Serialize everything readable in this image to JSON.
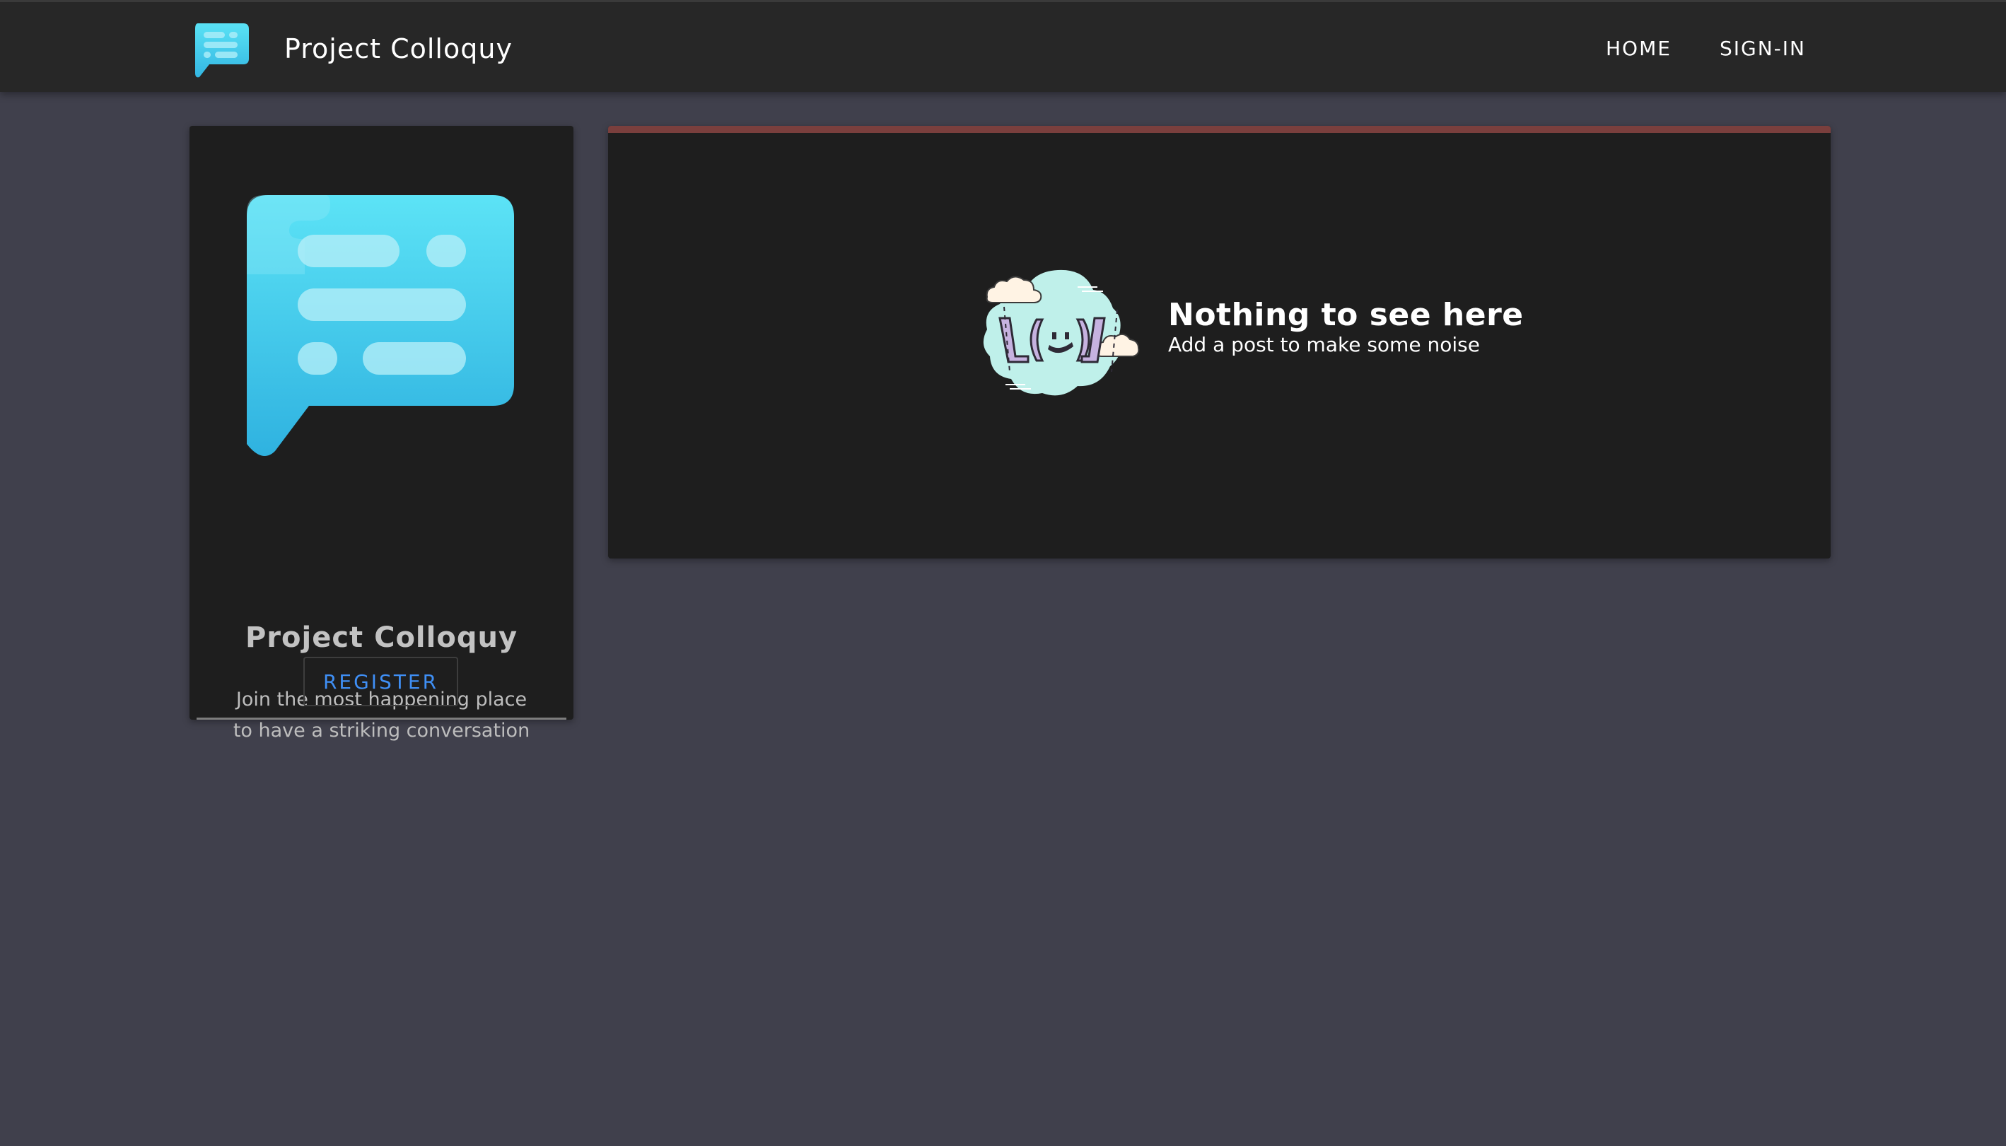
{
  "header": {
    "brand_title": "Project Colloquy",
    "logo_icon": "chat-bubble-icon",
    "nav": [
      {
        "label": "HOME"
      },
      {
        "label": "SIGN-IN"
      }
    ]
  },
  "sidebar_card": {
    "logo_icon": "chat-bubble-icon",
    "title": "Project Colloquy",
    "description_line1": "Join the most happening place",
    "description_line2": "to have a striking conversation",
    "register_label": "REGISTER"
  },
  "main": {
    "empty_state": {
      "illustration": "shrug-cloud-illustration",
      "title": "Nothing to see here",
      "subtitle": "Add a post to make some noise"
    }
  },
  "colors": {
    "page_background": "#40404c",
    "header_background": "#272727",
    "card_background": "#1e1e1e",
    "accent_bar": "#7a3f3d",
    "link_blue": "#3f8ff5",
    "logo_cyan": "#4fd8f0"
  }
}
